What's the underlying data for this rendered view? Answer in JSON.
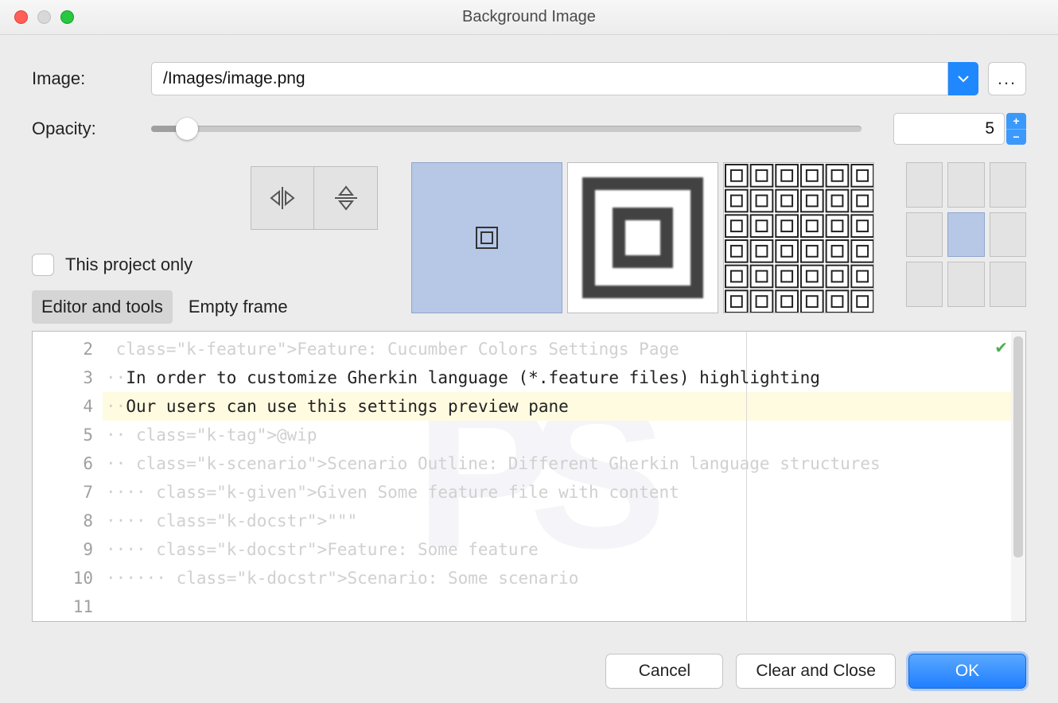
{
  "window": {
    "title": "Background Image"
  },
  "fields": {
    "image_label": "Image:",
    "image_path": "/Images/image.png",
    "browse": "...",
    "opacity_label": "Opacity:",
    "opacity_value": "5"
  },
  "checkbox": {
    "label": "This project only"
  },
  "tabs": {
    "active": "Editor and tools",
    "inactive": "Empty frame"
  },
  "editor": {
    "gutter": [
      "2",
      "3",
      "4",
      "5",
      "6",
      "7",
      "8",
      "9",
      "10",
      "11"
    ],
    "lines": [
      {
        "pre": "",
        "kw": "Feature:",
        "kwc": "k-feature",
        "rest": " Cucumber Colors Settings Page"
      },
      {
        "pre": "  ",
        "kw": "",
        "kwc": "",
        "rest": "In order to customize Gherkin language (*.feature files) highlighting"
      },
      {
        "pre": "  ",
        "kw": "",
        "kwc": "",
        "rest": "Our users can use this settings preview pane"
      },
      {
        "pre": "",
        "kw": "",
        "kwc": "",
        "rest": ""
      },
      {
        "pre": "  ",
        "kw": "@wip",
        "kwc": "k-tag",
        "rest": ""
      },
      {
        "pre": "  ",
        "kw": "Scenario Outline:",
        "kwc": "k-scenario",
        "rest": " Different Gherkin language structures"
      },
      {
        "pre": "    ",
        "kw": "Given",
        "kwc": "k-given",
        "rest": " Some feature file with content"
      },
      {
        "pre": "    ",
        "kw": "\"\"\"",
        "kwc": "k-docstr",
        "rest": ""
      },
      {
        "pre": "    ",
        "kw": "Feature: Some feature",
        "kwc": "k-docstr",
        "rest": ""
      },
      {
        "pre": "      ",
        "kw": "Scenario: Some scenario",
        "kwc": "k-docstr",
        "rest": ""
      }
    ]
  },
  "buttons": {
    "cancel": "Cancel",
    "clear": "Clear and Close",
    "ok": "OK"
  }
}
